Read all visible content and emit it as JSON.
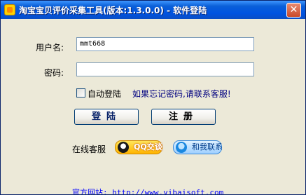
{
  "window": {
    "title": "淘宝宝贝评价采集工具(版本:1.3.0.0) - 软件登陆",
    "close_glyph": "✕"
  },
  "form": {
    "username_label": "用户名:",
    "username_value": "mmt668",
    "password_label": "密码:",
    "password_value": "",
    "auto_login_label": "自动登陆",
    "auto_login_checked": false,
    "forgot_text": "如果忘记密码,请联系客服!"
  },
  "buttons": {
    "login_label": "登陆",
    "register_label": "注册"
  },
  "support": {
    "label": "在线客服",
    "qq_talk_label": "QQ交谈",
    "qq_contact_label": "和我联系"
  },
  "footer": {
    "site_label": "官方网站:",
    "site_url": "http://www.yibaisoft.com"
  }
}
